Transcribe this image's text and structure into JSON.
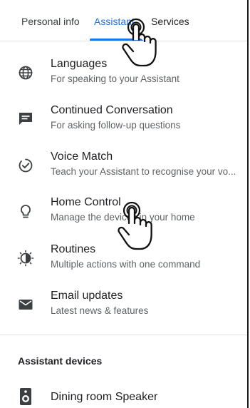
{
  "tabs": {
    "personal_info": "Personal info",
    "assistant": "Assistant",
    "services": "Services",
    "active_color": "#1a73e8"
  },
  "settings": [
    {
      "title": "Languages",
      "subtitle": "For speaking to your Assistant",
      "icon": "globe-icon"
    },
    {
      "title": "Continued Conversation",
      "subtitle": "For asking follow-up questions",
      "icon": "chat-icon"
    },
    {
      "title": "Voice Match",
      "subtitle": "Teach your Assistant to recognise your vo...",
      "icon": "voice-match-icon"
    },
    {
      "title": "Home Control",
      "subtitle": "Manage the devices in your home",
      "icon": "lightbulb-icon"
    },
    {
      "title": "Routines",
      "subtitle": "Multiple actions with one command",
      "icon": "routines-icon"
    },
    {
      "title": "Email updates",
      "subtitle": "Latest news & features",
      "icon": "mail-icon"
    }
  ],
  "devices_section": {
    "heading": "Assistant devices",
    "items": [
      {
        "label": "Dining room Speaker",
        "icon": "speaker-icon"
      }
    ]
  },
  "colors": {
    "text_primary": "#202124",
    "text_secondary": "#5f6368",
    "icon": "#3c4043",
    "divider": "#e3e3e3"
  }
}
